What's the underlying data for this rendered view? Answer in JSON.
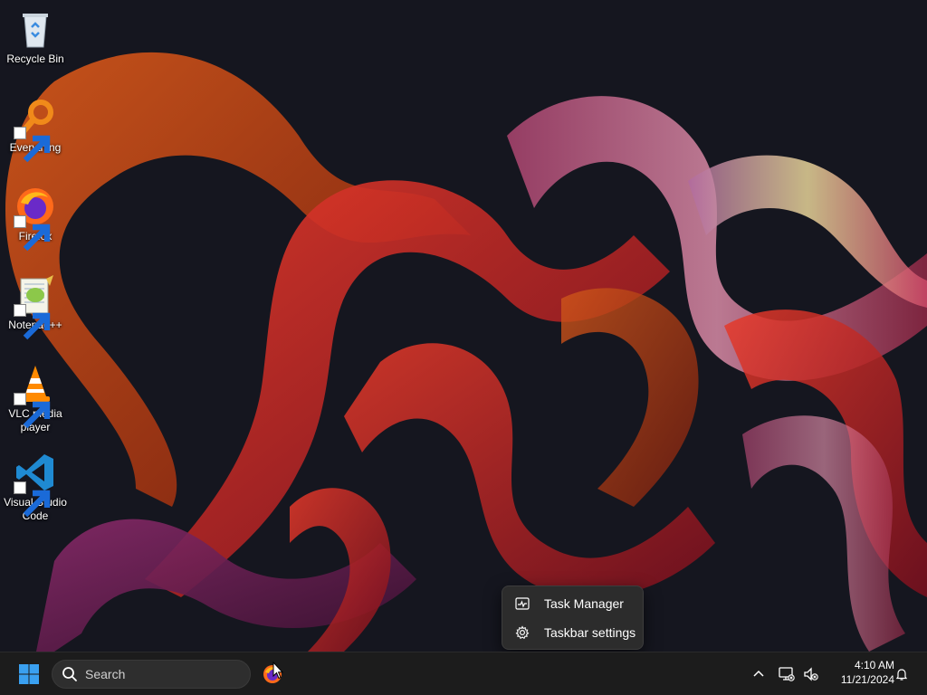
{
  "desktop": {
    "icons": [
      {
        "label": "Recycle Bin",
        "icon": "recycle-bin-icon"
      },
      {
        "label": "Everything",
        "icon": "everything-search-icon"
      },
      {
        "label": "Firefox",
        "icon": "firefox-icon"
      },
      {
        "label": "Notepad++",
        "icon": "notepad-plus-plus-icon"
      },
      {
        "label": "VLC media player",
        "icon": "vlc-cone-icon"
      },
      {
        "label": "Visual Studio Code",
        "icon": "vscode-icon"
      }
    ]
  },
  "context_menu": {
    "items": [
      {
        "label": "Task Manager",
        "icon": "task-manager-icon"
      },
      {
        "label": "Taskbar settings",
        "icon": "gear-icon"
      }
    ]
  },
  "taskbar": {
    "search_label": "Search",
    "clock_time": "4:10 AM",
    "clock_date": "11/21/2024"
  },
  "colors": {
    "taskbar_bg": "#1c1c1c",
    "menu_bg": "#2c2c2c",
    "start_blue": "#3aa0f0"
  }
}
